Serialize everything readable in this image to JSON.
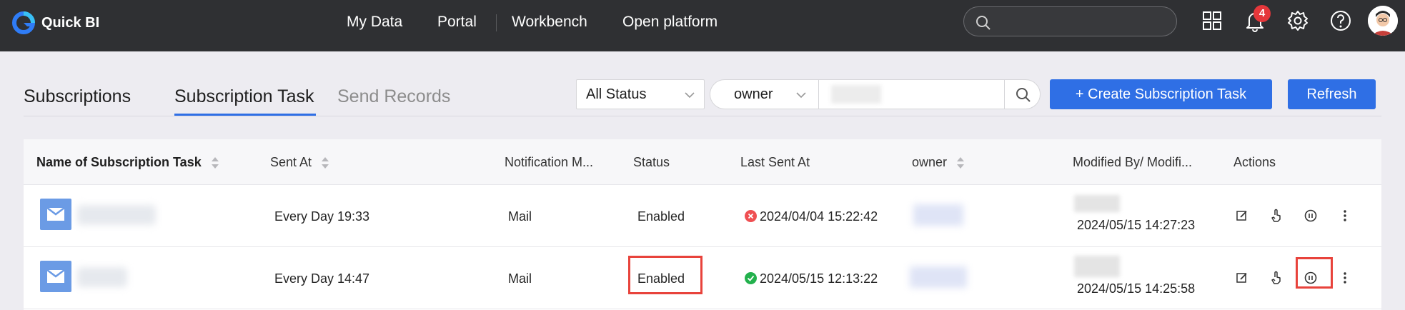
{
  "app": {
    "logo_text": "Quick BI",
    "brand_color": "#2f6fe5"
  },
  "nav": {
    "items": [
      "My Data",
      "Portal",
      "Workbench",
      "Open platform"
    ],
    "notification_count": "4"
  },
  "tabs": [
    {
      "label": "Subscriptions"
    },
    {
      "label": "Subscription Task"
    },
    {
      "label": "Send Records"
    }
  ],
  "filters": {
    "status_select": "All Status",
    "owner_select": "owner",
    "create_label": "+ Create Subscription Task",
    "refresh_label": "Refresh"
  },
  "table": {
    "headers": [
      "Name of Subscription Task",
      "Sent At",
      "Notification M...",
      "Status",
      "Last Sent At",
      "owner",
      "Modified By/ Modifi...",
      "Actions"
    ],
    "rows": [
      {
        "sent_at": "Every Day 19:33",
        "notification": "Mail",
        "status": "Enabled",
        "last_sent_at": "2024/04/04 15:22:42",
        "last_sent_state": "error",
        "modified_at": "2024/05/15 14:27:23"
      },
      {
        "sent_at": "Every Day 14:47",
        "notification": "Mail",
        "status": "Enabled",
        "last_sent_at": "2024/05/15 12:13:22",
        "last_sent_state": "success",
        "modified_at": "2024/05/15 14:25:58"
      }
    ]
  },
  "colors": {
    "error": "#ef4f52",
    "success": "#23b14d",
    "highlight": "#e8433c"
  }
}
